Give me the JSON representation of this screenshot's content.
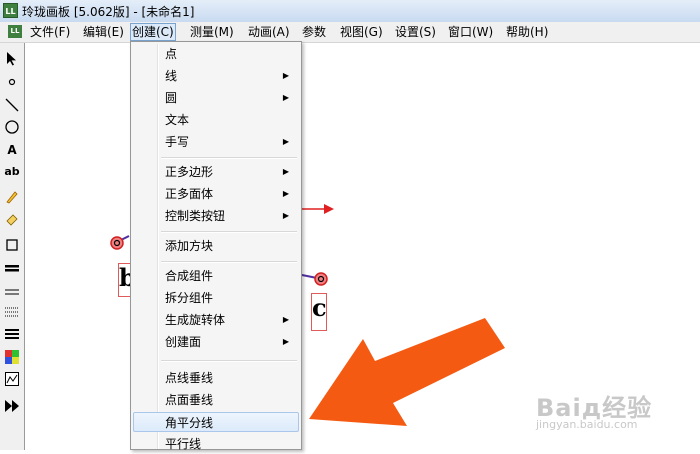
{
  "window": {
    "title": "玲珑画板 [5.062版] - [未命名1]",
    "icon_text": "LL"
  },
  "menubar": {
    "items": [
      {
        "label": "文件(F)"
      },
      {
        "label": "编辑(E)"
      },
      {
        "label": "创建(C)"
      },
      {
        "label": "测量(M)"
      },
      {
        "label": "动画(A)"
      },
      {
        "label": "参数"
      },
      {
        "label": "视图(G)"
      },
      {
        "label": "设置(S)"
      },
      {
        "label": "窗口(W)"
      },
      {
        "label": "帮助(H)"
      }
    ]
  },
  "toolbox": {
    "text_tool": "A",
    "label_tool": "ab"
  },
  "canvas": {
    "labels": [
      "b",
      "c"
    ]
  },
  "create_menu": {
    "items": [
      {
        "label": "点",
        "submenu": false
      },
      {
        "label": "线",
        "submenu": true
      },
      {
        "label": "圆",
        "submenu": true
      },
      {
        "label": "文本",
        "submenu": false
      },
      {
        "label": "手写",
        "submenu": true
      },
      {
        "label": "正多边形",
        "submenu": true
      },
      {
        "label": "正多面体",
        "submenu": true
      },
      {
        "label": "控制类按钮",
        "submenu": true
      },
      {
        "label": "添加方块",
        "submenu": false
      },
      {
        "label": "合成组件",
        "submenu": false
      },
      {
        "label": "拆分组件",
        "submenu": false
      },
      {
        "label": "生成旋转体",
        "submenu": true
      },
      {
        "label": "创建面",
        "submenu": true
      },
      {
        "label": "点线垂线",
        "submenu": false
      },
      {
        "label": "点面垂线",
        "submenu": false
      },
      {
        "label": "角平分线",
        "submenu": false,
        "highlighted": true
      },
      {
        "label": "平行线",
        "submenu": false
      }
    ],
    "arrow_glyph": "▶"
  },
  "watermark": {
    "main": "Baiд经验",
    "sub": "jingyan.baidu.com"
  },
  "colors": {
    "annotation_arrow": "#f05a14",
    "point_red": "#e04040",
    "menu_highlight": "#dceafa"
  }
}
